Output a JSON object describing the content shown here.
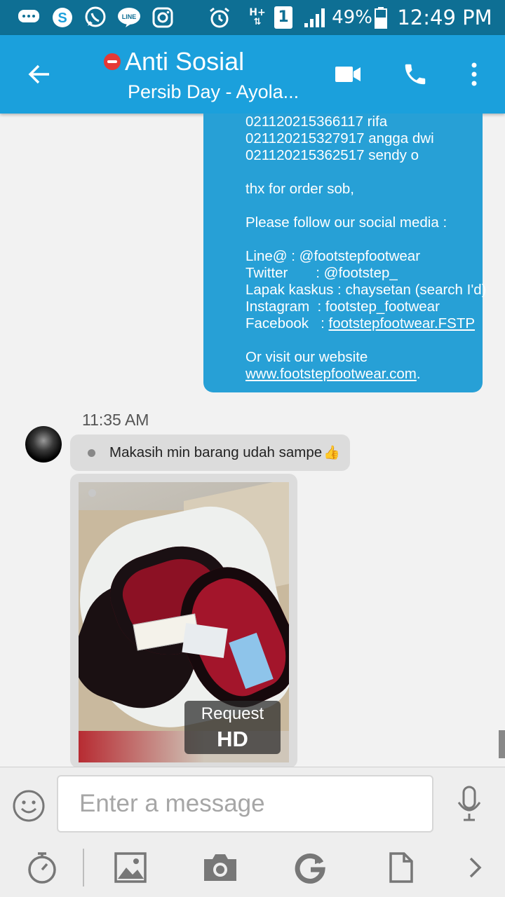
{
  "status_bar": {
    "battery_percent": "49%",
    "time": "12:49 PM",
    "network_badge": "1",
    "network_type": "H+",
    "notification_icons": [
      "chat-bubble-icon",
      "skype-icon",
      "whatsapp-icon",
      "line-icon",
      "instagram-icon"
    ],
    "system_icons": [
      "alarm-icon",
      "signal-icon",
      "battery-icon"
    ]
  },
  "header": {
    "title": "Anti Sosial",
    "subtitle": "Persib Day - Ayola...",
    "status_badge": "do-not-disturb-icon",
    "actions": [
      "video-call-icon",
      "phone-call-icon",
      "more-vert-icon"
    ]
  },
  "conversation": {
    "outgoing": {
      "lines": [
        "021120215366117 rifa",
        "021120215327917 angga dwi",
        "021120215362517 sendy o",
        "",
        "thx for order sob,",
        "",
        "Please follow our social media :",
        "",
        "Line@ : @footstepfootwear",
        "Twitter       : @footstep_",
        "Lapak kaskus : chaysetan (search I'd)",
        "Instagram  : footstep_footwear",
        "Facebook   : ",
        "",
        "Or visit our website"
      ],
      "facebook_link": "footstepfootwear.FSTP",
      "website_link": "www.footstepfootwear.com",
      "website_suffix": "."
    },
    "timestamp": "11:35 AM",
    "incoming": {
      "text": "Makasih min barang udah sampe",
      "emoji": "👍"
    },
    "photo": {
      "request_line1": "Request",
      "request_line2": "HD"
    }
  },
  "composer": {
    "placeholder": "Enter a message",
    "tools": [
      "timer-icon",
      "gallery-icon",
      "camera-icon",
      "gif-icon",
      "document-icon",
      "chevron-right-icon"
    ]
  },
  "colors": {
    "status_bar": "#0e6f94",
    "app_bar": "#1ba0dc",
    "outgoing_bubble": "#27a0d6",
    "incoming_bubble": "#dcdcdc",
    "background": "#f2f2f2"
  }
}
